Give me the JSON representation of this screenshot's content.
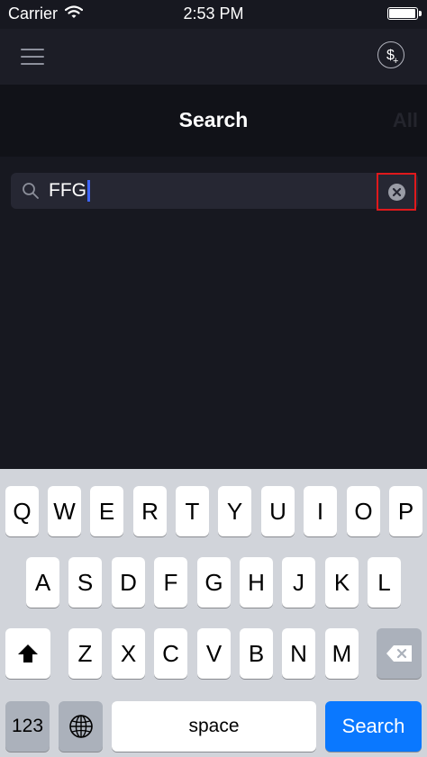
{
  "status_bar": {
    "carrier": "Carrier",
    "time": "2:53 PM",
    "battery_level": 1.0
  },
  "nav": {
    "menu_icon": "hamburger-menu-icon",
    "money_icon": "dollar-add-icon"
  },
  "title_bar": {
    "title": "Search",
    "right_label": "All"
  },
  "search": {
    "value": "FFG",
    "search_icon": "magnifier-icon",
    "clear_icon": "clear-x-icon"
  },
  "keyboard": {
    "row1": [
      "Q",
      "W",
      "E",
      "R",
      "T",
      "Y",
      "U",
      "I",
      "O",
      "P"
    ],
    "row2": [
      "A",
      "S",
      "D",
      "F",
      "G",
      "H",
      "J",
      "K",
      "L"
    ],
    "row3": [
      "Z",
      "X",
      "C",
      "V",
      "B",
      "N",
      "M"
    ],
    "numbers_label": "123",
    "space_label": "space",
    "return_label": "Search",
    "shift_icon": "shift-arrow-icon",
    "delete_icon": "backspace-icon",
    "globe_icon": "globe-icon",
    "accent_color": "#0a78ff"
  }
}
